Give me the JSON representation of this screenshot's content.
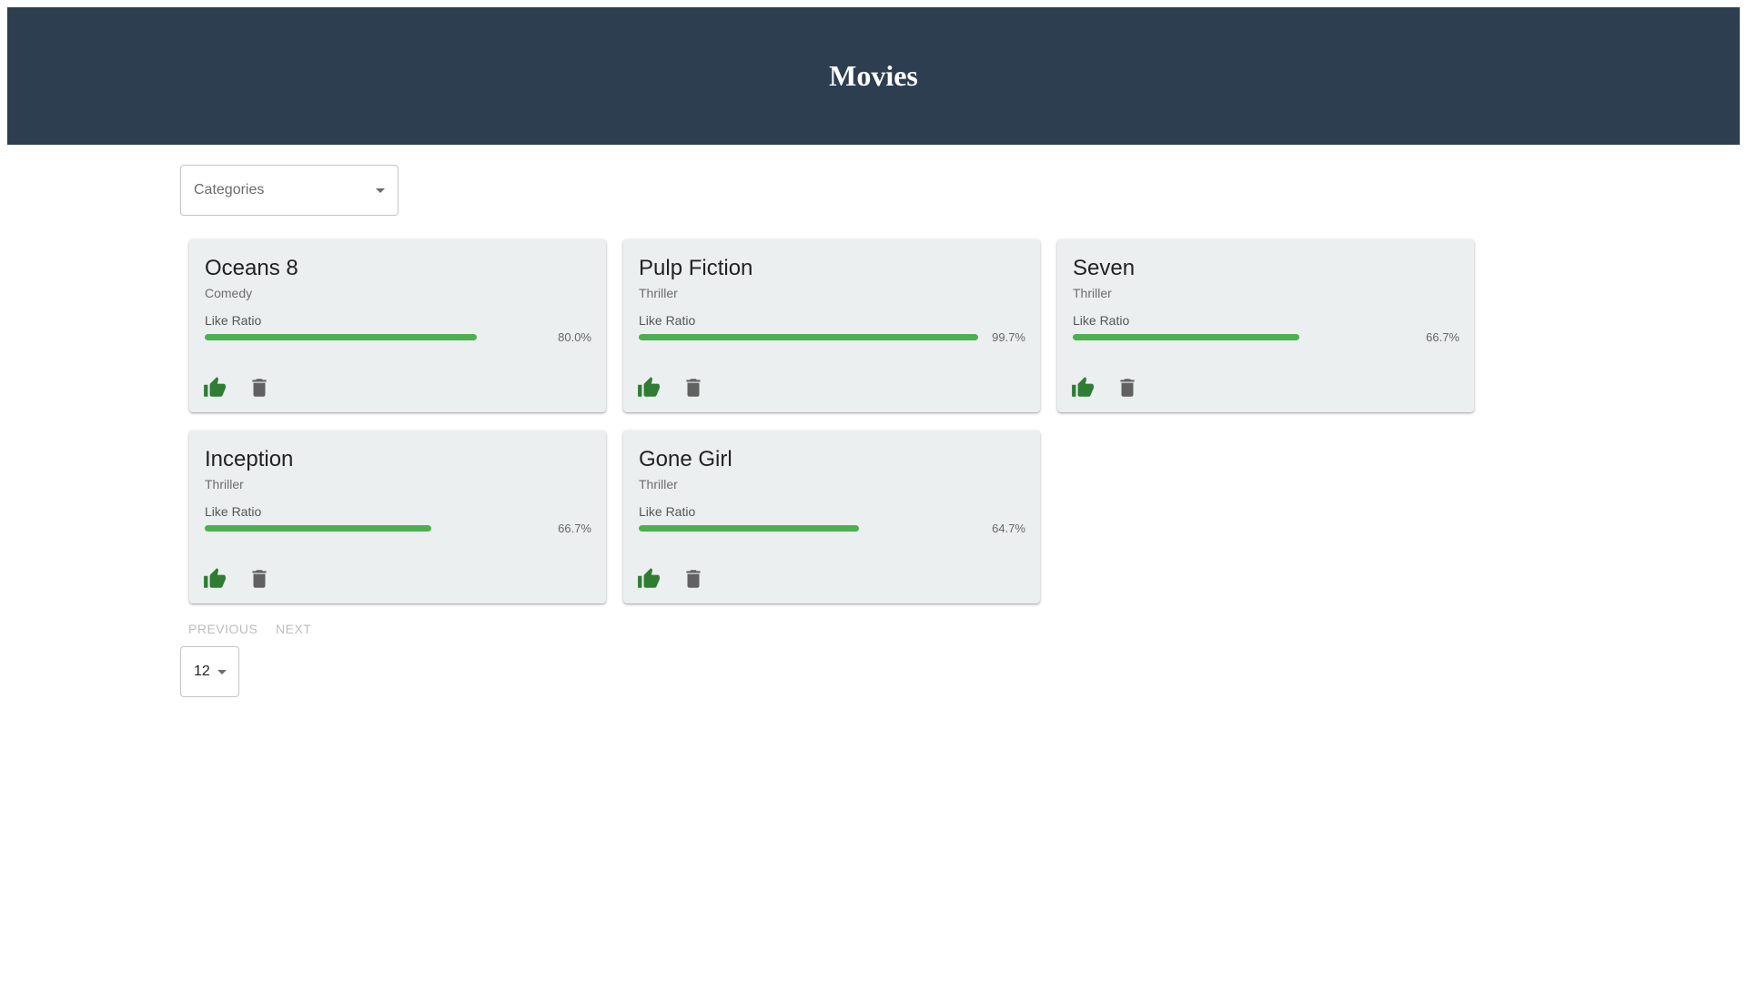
{
  "header": {
    "title": "Movies"
  },
  "filter": {
    "category_placeholder": "Categories"
  },
  "colors": {
    "header_bg": "#2c3e50",
    "card_bg": "#eceff0",
    "bar_fill": "#4caf50",
    "like_icon": "#2e7d32",
    "delete_icon": "#616161"
  },
  "movies": [
    {
      "title": "Oceans 8",
      "category": "Comedy",
      "ratio_label": "Like Ratio",
      "ratio_text": "80.0%",
      "ratio": 0.8
    },
    {
      "title": "Pulp Fiction",
      "category": "Thriller",
      "ratio_label": "Like Ratio",
      "ratio_text": "99.7%",
      "ratio": 0.997
    },
    {
      "title": "Seven",
      "category": "Thriller",
      "ratio_label": "Like Ratio",
      "ratio_text": "66.7%",
      "ratio": 0.667
    },
    {
      "title": "Inception",
      "category": "Thriller",
      "ratio_label": "Like Ratio",
      "ratio_text": "66.7%",
      "ratio": 0.667
    },
    {
      "title": "Gone Girl",
      "category": "Thriller",
      "ratio_label": "Like Ratio",
      "ratio_text": "64.7%",
      "ratio": 0.647
    }
  ],
  "card_icons": {
    "like": "thumb-up-icon",
    "delete": "trash-icon"
  },
  "pagination": {
    "previous_label": "PREVIOUS",
    "next_label": "NEXT",
    "per_page_value": "12"
  }
}
